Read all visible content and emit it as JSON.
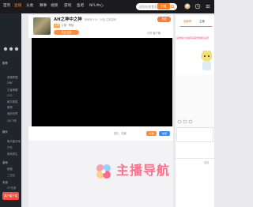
{
  "topnav": {
    "items": [
      "首页",
      "直播",
      "分类",
      "赛事",
      "视频",
      "游戏",
      "鱼吧",
      "NFL中心"
    ],
    "active_index": 1,
    "search_placeholder": "孤独的美食家2",
    "right_btn": "下载"
  },
  "sidebar": {
    "headers": [
      "推荐",
      "娱乐",
      "游戏",
      "手游"
    ],
    "items": [
      "英雄联盟",
      "DNF",
      "王者荣耀",
      "CS2",
      "和平精英",
      "原神",
      "我的世界",
      "QQ飞车",
      "鱼乐星天地",
      "户外",
      "绝地求生",
      "颜值",
      "二次元",
      "CF手游"
    ],
    "bottom_btn": "客户端下载"
  },
  "room": {
    "title": "AH之神中之神",
    "meta": "房间号:101  ·  分区:主机游戏",
    "tag": "大神",
    "tag_rest": "主播 · 等级",
    "follow_label": "关注主播",
    "share_items": "分享  客户端",
    "hot_label": "热度",
    "report_label": "举报"
  },
  "video_bar": {
    "stats": "送礼  ·  热度",
    "gift_label": "礼物",
    "send_label": "充值"
  },
  "right_panel": {
    "tabs": [
      "贡献榜",
      "主播"
    ],
    "active_tab": 0,
    "banner": "鱼粉超V主播获得荣誉福利来袭",
    "login_text": "发送"
  },
  "watermark": {
    "text": "主播导航"
  },
  "colors": {
    "accent": "#ff7a1a",
    "nav_bg": "#1a1a1f",
    "sidebar_bg": "#20242b",
    "watermark": "#ff5a7a"
  }
}
